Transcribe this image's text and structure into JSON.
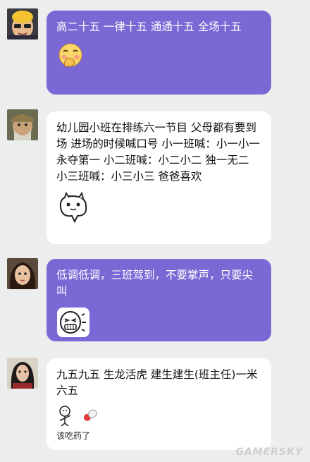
{
  "messages": [
    {
      "text": "高二十五 一律十五 通通十五 全场十五",
      "sticker": "face-with-hand-over-mouth-sticker",
      "bubble_color": "#7b68d5"
    },
    {
      "text": "幼儿园小班在排练六一节目 父母都有要到场 进场的时候喊口号 小一班喊：小一小一 永夺第一 小二班喊：小二小二 独一无二 小三班喊：小三小三 爸爸喜欢",
      "sticker": "cat-ghost-sticker",
      "bubble_color": "#ffffff"
    },
    {
      "text": "低调低调，三班驾到，不要掌声，只要尖叫",
      "sticker": "laughing-face-sticker",
      "bubble_color": "#7b68d5"
    },
    {
      "text": "九五九五 生龙活虎 建生建生(班主任)一米六五",
      "sticker": "take-medicine-sticker",
      "sticker_caption": "该吃药了",
      "bubble_color": "#ffffff"
    }
  ],
  "watermark": "GAMERSKY"
}
